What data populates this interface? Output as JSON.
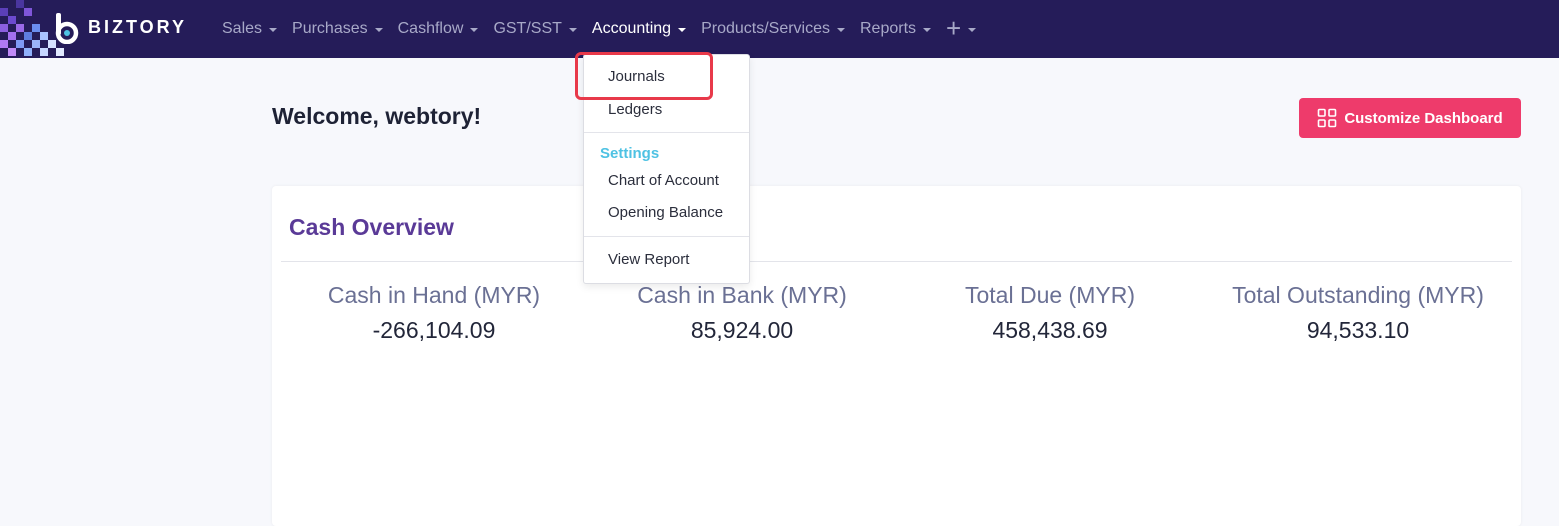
{
  "brand": {
    "name": "BIZTORY"
  },
  "nav": {
    "items": [
      {
        "label": "Sales"
      },
      {
        "label": "Purchases"
      },
      {
        "label": "Cashflow"
      },
      {
        "label": "GST/SST"
      },
      {
        "label": "Accounting",
        "active": true
      },
      {
        "label": "Products/Services"
      },
      {
        "label": "Reports"
      }
    ],
    "add_icon": "plus-icon"
  },
  "page": {
    "welcome": "Welcome, webtory!",
    "customize_label": "Customize Dashboard"
  },
  "card": {
    "title": "Cash Overview",
    "metrics": [
      {
        "label": "Cash in Hand (MYR)",
        "value": "-266,104.09"
      },
      {
        "label": "Cash in Bank (MYR)",
        "value": "85,924.00"
      },
      {
        "label": "Total Due (MYR)",
        "value": "458,438.69"
      },
      {
        "label": "Total Outstanding (MYR)",
        "value": "94,533.10"
      }
    ]
  },
  "dropdown": {
    "items": [
      "Journals",
      "Ledgers"
    ],
    "settings_header": "Settings",
    "settings_items": [
      "Chart of Account",
      "Opening Balance"
    ],
    "report_item": "View Report"
  },
  "colors": {
    "navbar": "#251c59",
    "accent": "#ee3b6b",
    "title": "#5a3a97",
    "settings": "#4ec2e3",
    "highlight": "#e8394a"
  }
}
